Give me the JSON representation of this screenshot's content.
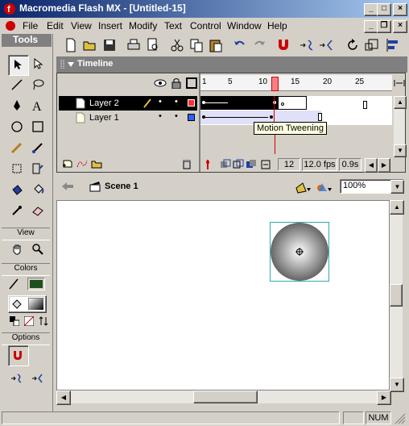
{
  "window": {
    "title": "Macromedia Flash MX - [Untitled-15]",
    "min": "_",
    "max": "□",
    "close": "×",
    "doc_min": "_",
    "doc_restore": "❐",
    "doc_close": "×"
  },
  "menu": [
    "File",
    "Edit",
    "View",
    "Insert",
    "Modify",
    "Text",
    "Control",
    "Window",
    "Help"
  ],
  "tools": {
    "title": "Tools",
    "view_label": "View",
    "colors_label": "Colors",
    "options_label": "Options",
    "stroke_color": "#1f4f1f",
    "fill_color": "#000000"
  },
  "timeline": {
    "title": "Timeline",
    "ruler": [
      "1",
      "5",
      "10",
      "15",
      "20",
      "25"
    ],
    "layers": [
      {
        "name": "Layer 2",
        "selected": true,
        "color": "#ff3030"
      },
      {
        "name": "Layer 1",
        "selected": false,
        "color": "#3060ff"
      }
    ],
    "tooltip": "Motion Tweening",
    "current_frame": "12",
    "fps": "12.0 fps",
    "time": "0.9s"
  },
  "scene": {
    "name": "Scene 1",
    "zoom": "100%"
  },
  "status": {
    "num": "NUM"
  }
}
